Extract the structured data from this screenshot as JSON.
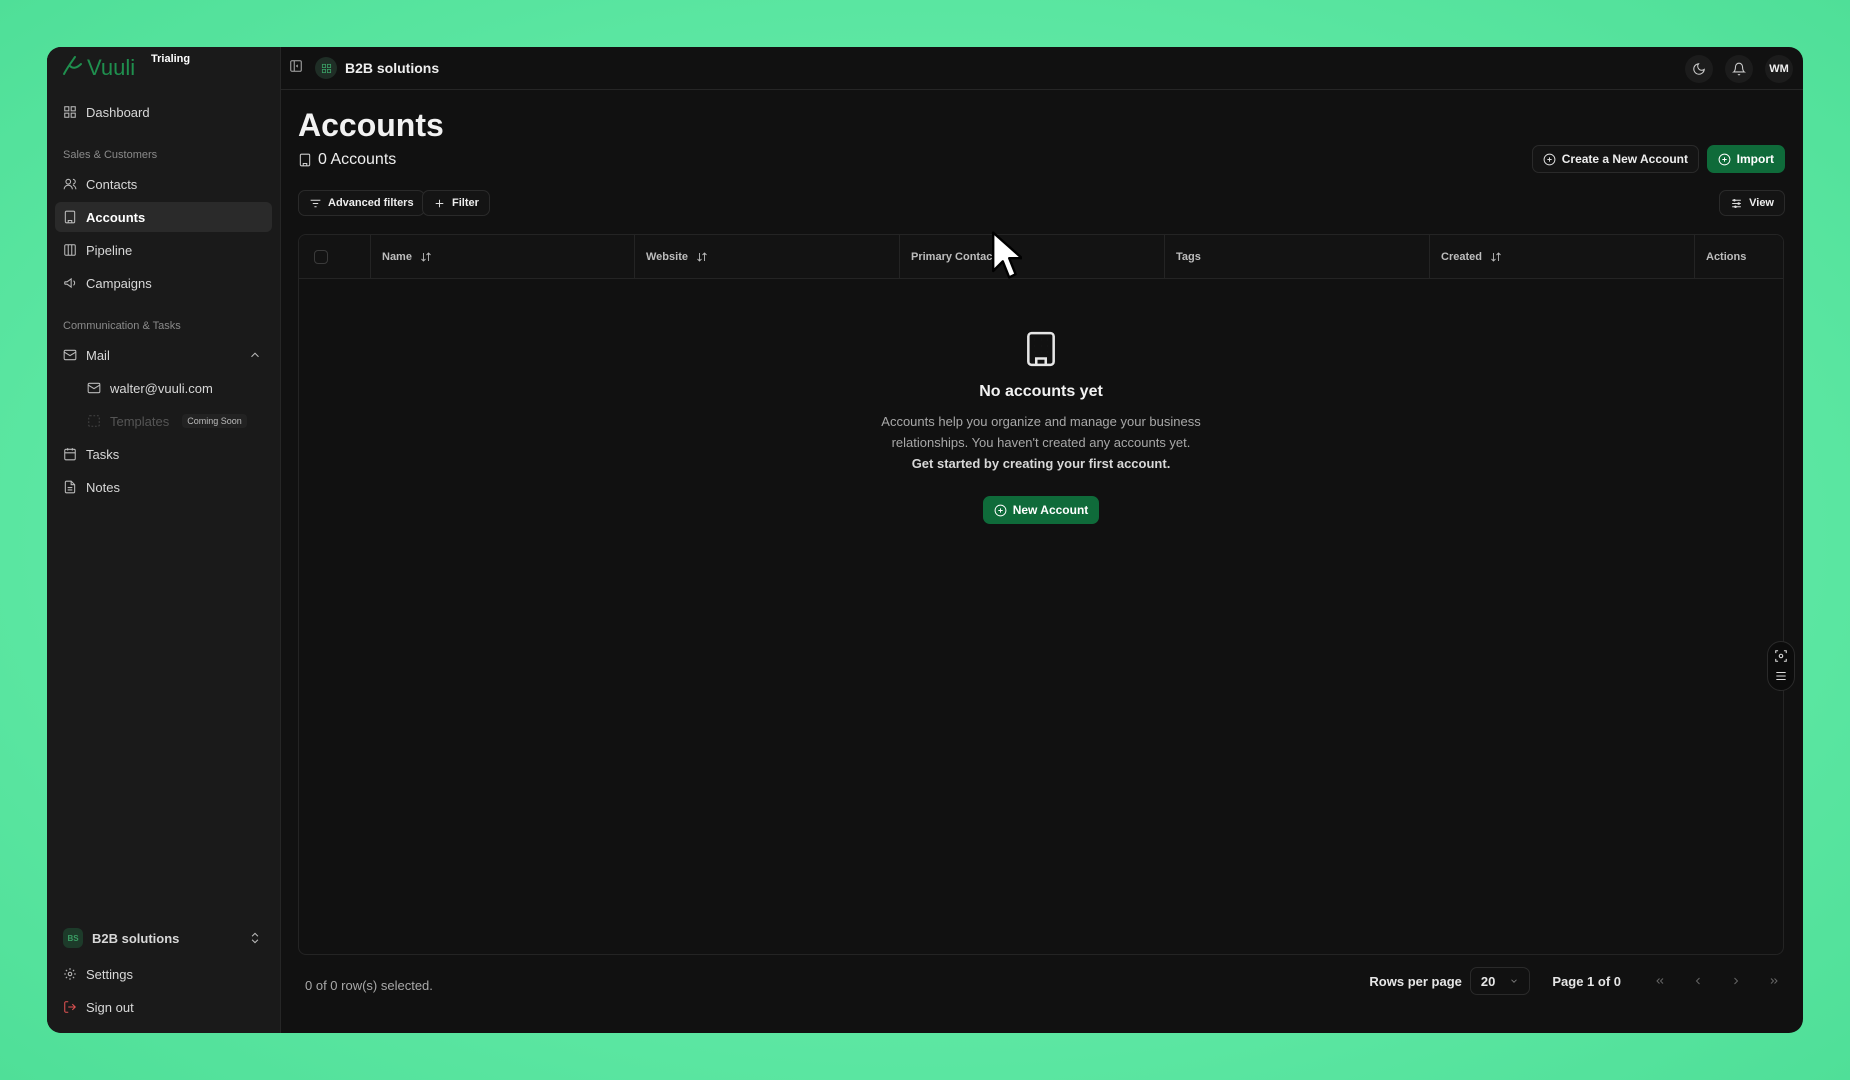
{
  "brand": {
    "name": "Vuuli",
    "badge": "Trialing"
  },
  "sidebar": {
    "top_items": [
      {
        "label": "Dashboard",
        "icon": "dashboard-icon"
      }
    ],
    "sections": [
      {
        "label": "Sales & Customers",
        "items": [
          {
            "label": "Contacts",
            "icon": "contacts-icon"
          },
          {
            "label": "Accounts",
            "icon": "accounts-icon",
            "active": true
          },
          {
            "label": "Pipeline",
            "icon": "pipeline-icon"
          },
          {
            "label": "Campaigns",
            "icon": "megaphone-icon"
          }
        ]
      },
      {
        "label": "Communication & Tasks",
        "items": [
          {
            "label": "Mail",
            "icon": "mail-icon",
            "expanded": true,
            "children": [
              {
                "label": "walter@vuuli.com",
                "icon": "mail-icon"
              },
              {
                "label": "Templates",
                "icon": "template-icon",
                "badge": "Coming Soon",
                "disabled": true
              }
            ]
          },
          {
            "label": "Tasks",
            "icon": "calendar-icon"
          },
          {
            "label": "Notes",
            "icon": "notes-icon"
          }
        ]
      }
    ],
    "bottom": {
      "org": {
        "initials": "BS",
        "name": "B2B solutions"
      },
      "settings": "Settings",
      "signout": "Sign out"
    }
  },
  "topbar": {
    "workspace": "B2B solutions",
    "avatar": "WM"
  },
  "page": {
    "title": "Accounts",
    "count_label": "0 Accounts",
    "create_button": "Create a New Account",
    "import_button": "Import",
    "advanced_filters": "Advanced filters",
    "filter": "Filter",
    "view": "View"
  },
  "table": {
    "columns": [
      "Name",
      "Website",
      "Primary Contact",
      "Tags",
      "Created",
      "Actions"
    ],
    "empty": {
      "title": "No accounts yet",
      "description": "Accounts help you organize and manage your business relationships. You haven't created any accounts yet.",
      "cta": "Get started by creating your first account.",
      "button": "New Account"
    }
  },
  "footer": {
    "selected": "0 of 0 row(s) selected.",
    "rows_per_page_label": "Rows per page",
    "rows_per_page": "20",
    "page_info": "Page 1 of 0"
  },
  "colors": {
    "accent": "#0f6b3a",
    "background": "#111111",
    "sidebar": "#1a1a1a",
    "danger": "#e05252"
  }
}
